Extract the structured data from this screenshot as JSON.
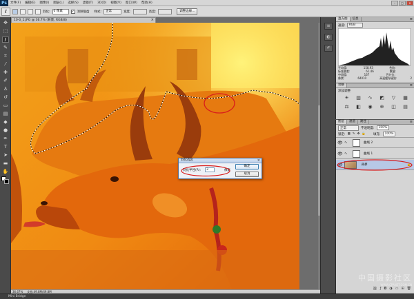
{
  "app": {
    "logo": "Ps"
  },
  "menubar": {
    "items": [
      "文件(F)",
      "编辑(E)",
      "图像(I)",
      "图层(L)",
      "选择(S)",
      "滤镜(T)",
      "3D(D)",
      "视图(V)",
      "窗口(W)",
      "帮助(H)"
    ]
  },
  "optionsbar": {
    "feather_label": "羽化:",
    "feather_value": "0 像素",
    "antialias_label": "消除锯齿",
    "style_label": "样式:",
    "style_value": "正常",
    "width_label": "宽度:",
    "height_label": "高度:",
    "refine_button": "调整边缘..."
  },
  "document": {
    "tab_title": "10-0_1.JPG @ 36.7% (背景, RGB/8)"
  },
  "status": {
    "zoom": "36.67%",
    "doc_info": "文档:49.8M/49.8M"
  },
  "bridge": {
    "label": "Mini Bridge"
  },
  "dialog": {
    "title": "羽化选区",
    "radius_label": "羽化半径(R):",
    "radius_value": "3",
    "unit": "像素",
    "ok_button": "确定",
    "cancel_button": "取消"
  },
  "histogram": {
    "tabs": [
      "直方图",
      "信息"
    ],
    "channel_label": "通道:",
    "channel_value": "RGB",
    "stats": [
      [
        "平均值:",
        "158.93",
        "色阶:",
        ""
      ],
      [
        "标准偏差:",
        "61.46",
        "数量:",
        ""
      ],
      [
        "中间值:",
        "167",
        "百分位:",
        ""
      ],
      [
        "像素:",
        "64010",
        "高速缓存级别:",
        "2"
      ]
    ]
  },
  "adjustments": {
    "tabs": [
      "调整"
    ],
    "add_label": "添加调整"
  },
  "layers": {
    "tabs": [
      "图层",
      "通道",
      "路径"
    ],
    "blend_mode": "正常",
    "opacity_label": "不透明度:",
    "opacity_value": "100%",
    "lock_label": "锁定:",
    "fill_label": "填充:",
    "fill_value": "100%",
    "items": [
      {
        "name": "曲线 2"
      },
      {
        "name": "曲线 1"
      },
      {
        "name": "背景"
      }
    ]
  },
  "watermark": {
    "text": "中国摄影社区",
    "subtext": "WWW.CPANET.COM.CN"
  },
  "colors": {
    "annotation": "#d91c1c",
    "selected_layer": "#b7c8e6"
  }
}
